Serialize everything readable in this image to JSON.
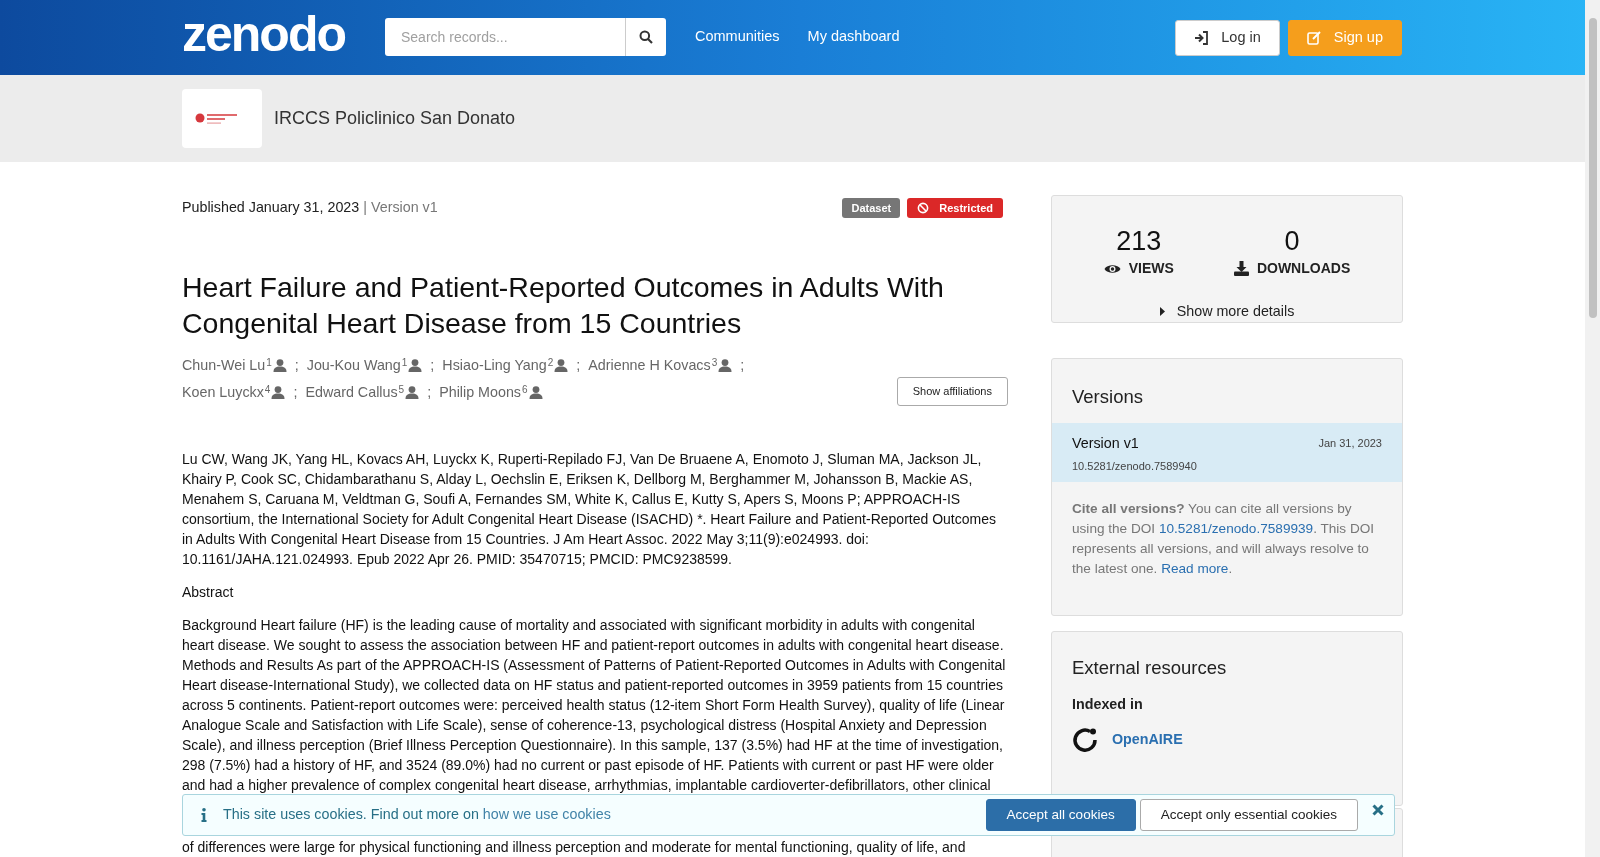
{
  "header": {
    "logo": "zenodo",
    "search": {
      "placeholder": "Search records..."
    },
    "nav": [
      "Communities",
      "My dashboard"
    ],
    "buttons": [
      {
        "label": "Log in",
        "kind": "login"
      },
      {
        "label": "Sign up",
        "kind": "signup"
      }
    ]
  },
  "community": {
    "name": "IRCCS Policlinico San Donato"
  },
  "record": {
    "published": "Published January 31, 2023",
    "version": "| Version v1",
    "badges": [
      {
        "label": "Dataset",
        "kind": "type"
      },
      {
        "label": "Restricted",
        "kind": "access"
      }
    ],
    "title": "Heart Failure and Patient-Reported Outcomes in Adults With Congenital Heart Disease from 15 Countries",
    "creators": [
      {
        "name": "Chun-Wei Lu",
        "affiliation": "1"
      },
      {
        "name": "Jou-Kou Wang",
        "affiliation": "1"
      },
      {
        "name": "Hsiao-Ling Yang",
        "affiliation": "2"
      },
      {
        "name": "Adrienne H Kovacs",
        "affiliation": "3"
      },
      {
        "name": "Koen Luyckx",
        "affiliation": "4"
      },
      {
        "name": "Edward Callus",
        "affiliation": "5"
      },
      {
        "name": "Philip Moons",
        "affiliation": "6"
      }
    ],
    "creator_separator": ";",
    "show_affiliations": "Show affiliations",
    "citation": "Lu CW, Wang JK, Yang HL, Kovacs AH, Luyckx K, Ruperti-Repilado FJ, Van De Bruaene A, Enomoto J, Sluman MA, Jackson JL, Khairy P, Cook SC, Chidambarathanu S, Alday L, Oechslin E, Eriksen K, Dellborg M, Berghammer M, Johansson B, Mackie AS, Menahem S, Caruana M, Veldtman G, Soufi A, Fernandes SM, White K, Callus E, Kutty S, Apers S, Moons P; APPROACH-IS consortium, the International Society for Adult Congenital Heart Disease (ISACHD) *. Heart Failure and Patient-Reported Outcomes in Adults With Congenital Heart Disease from 15 Countries. J Am Heart Assoc. 2022 May 3;11(9):e024993. doi: 10.1161/JAHA.121.024993. Epub 2022 Apr 26. PMID: 35470715; PMCID: PMC9238599.",
    "abstract_heading": "Abstract",
    "abstract": "Background Heart failure (HF) is the leading cause of mortality and associated with significant morbidity in adults with congenital heart disease. We sought to assess the association between HF and patient-report outcomes in adults with congenital heart disease. Methods and Results As part of the APPROACH-IS (Assessment of Patterns of Patient-Reported Outcomes in Adults with Congenital Heart disease-International Study), we collected data on HF status and patient-reported outcomes in 3959 patients from 15 countries across 5 continents. Patient-report outcomes were: perceived health status (12-item Short Form Health Survey), quality of life (Linear Analogue Scale and Satisfaction with Life Scale), sense of coherence-13, psychological distress (Hospital Anxiety and Depression Scale), and illness perception (Brief Illness Perception Questionnaire). In this sample, 137 (3.5%) had HF at the time of investigation, 298 (7.5%) had a history of HF, and 3524 (89.0%) had no current or past episode of HF. Patients with current or past HF were older and had a higher prevalence of complex congenital heart disease, arrhythmias, implantable cardioverter-defibrillators, other clinical",
    "abstract_continued": "of differences were large for physical functioning and illness perception and moderate for mental functioning, quality of life, and"
  },
  "stats": [
    {
      "value": "213",
      "label": "VIEWS",
      "kind": "views"
    },
    {
      "value": "0",
      "label": "DOWNLOADS",
      "kind": "downloads"
    }
  ],
  "show_more_details": "Show more details",
  "versions": {
    "title": "Versions",
    "items": [
      {
        "title": "Version v1",
        "doi": "10.5281/zenodo.7589940",
        "date": "Jan 31, 2023",
        "selected": true
      }
    ],
    "cite_bold": "Cite all versions?",
    "cite_text": "You can cite all versions by using the DOI",
    "cite_doi": "10.5281/zenodo.7589939",
    "cite_text2": ". This DOI represents all versions, and will always resolve to the latest one.",
    "read_more": "Read more",
    "cite_end": "."
  },
  "external": {
    "title": "External resources",
    "indexed_in": "Indexed in",
    "items": [
      {
        "name": "OpenAIRE"
      }
    ]
  },
  "cookie": {
    "text": "This site uses cookies. Find out more on",
    "link": "how we use cookies",
    "buttons": [
      {
        "label": "Accept all cookies",
        "kind": "primary"
      },
      {
        "label": "Accept only essential cookies",
        "kind": "secondary"
      }
    ]
  }
}
